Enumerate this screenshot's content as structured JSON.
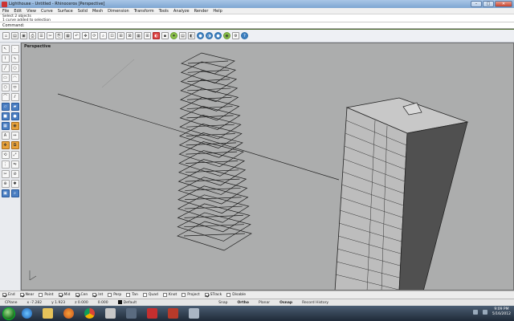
{
  "window": {
    "title": "Lighthouse - Untitled - Rhinoceros [Perspective]",
    "controls": {
      "minimize": "–",
      "maximize": "□",
      "close": "✕"
    }
  },
  "menu": [
    "File",
    "Edit",
    "View",
    "Curve",
    "Surface",
    "Solid",
    "Mesh",
    "Dimension",
    "Transform",
    "Tools",
    "Analyze",
    "Render",
    "Help"
  ],
  "command_history": [
    "Select 2 objects",
    "1 curve added to selection"
  ],
  "command_prompt": "Command:",
  "toolbar_icons": [
    "new-file-icon",
    "open-file-icon",
    "save-icon",
    "print-icon",
    "properties-icon",
    "cut-icon",
    "copy-icon",
    "paste-icon",
    "undo-icon",
    "pan-icon",
    "rotate-view-icon",
    "zoom-icon",
    "zoom-window-icon",
    "zoom-extents-icon",
    "zoom-selected-icon",
    "grid-icon",
    "four-view-icon",
    "hide-icon",
    "lock-icon",
    "light-icon",
    "layer-icon",
    "material-icon",
    "render-icon",
    "shade-icon",
    "sphere-icon",
    "color-icon",
    "options-icon",
    "help-icon"
  ],
  "sidebar_icons": [
    [
      "select-arrow-icon",
      "point-icon"
    ],
    [
      "polyline-icon",
      "curve-icon"
    ],
    [
      "line-icon",
      "circle-icon"
    ],
    [
      "rectangle-icon",
      "arc-icon"
    ],
    [
      "polygon-icon",
      "ellipse-icon"
    ],
    [
      "fillet-icon",
      "offset-icon"
    ],
    [
      "surface-icon",
      "extrude-icon"
    ],
    [
      "box-icon",
      "sphere-solid-icon"
    ],
    [
      "mesh-icon",
      "boolean-icon"
    ],
    [
      "text-icon",
      "dimension-icon"
    ],
    [
      "move-icon",
      "copy-object-icon"
    ],
    [
      "rotate-icon",
      "scale-icon"
    ],
    [
      "array-icon",
      "mirror-icon"
    ],
    [
      "trim-icon",
      "split-icon"
    ],
    [
      "join-icon",
      "explode-icon"
    ],
    [
      "group-icon",
      "analyze-icon"
    ]
  ],
  "viewport": {
    "label": "Perspective"
  },
  "osnap": [
    {
      "label": "End",
      "checked": true
    },
    {
      "label": "Near",
      "checked": true
    },
    {
      "label": "Point",
      "checked": false
    },
    {
      "label": "Mid",
      "checked": true
    },
    {
      "label": "Cen",
      "checked": true
    },
    {
      "label": "Int",
      "checked": true
    },
    {
      "label": "Perp",
      "checked": false
    },
    {
      "label": "Tan",
      "checked": false
    },
    {
      "label": "Quad",
      "checked": false
    },
    {
      "label": "Knot",
      "checked": false
    },
    {
      "label": "Project",
      "checked": false
    },
    {
      "label": "STrack",
      "checked": true
    },
    {
      "label": "Disable",
      "checked": false
    }
  ],
  "status": {
    "cplane": "CPlane",
    "x": "x -7.282",
    "y": "y 1.923",
    "z": "z 0.000",
    "units": "0.000",
    "layer": "Default",
    "snap": "Snap",
    "ortho": "Ortho",
    "planar": "Planar",
    "osnap": "Osnap",
    "record": "Record History"
  },
  "taskbar": {
    "time": "9:09 PM",
    "date": "5/16/2012"
  },
  "colors": {
    "viewport_bg": "#acadad",
    "titlebar": "#9dbde0",
    "taskbar": "#2a3646"
  }
}
